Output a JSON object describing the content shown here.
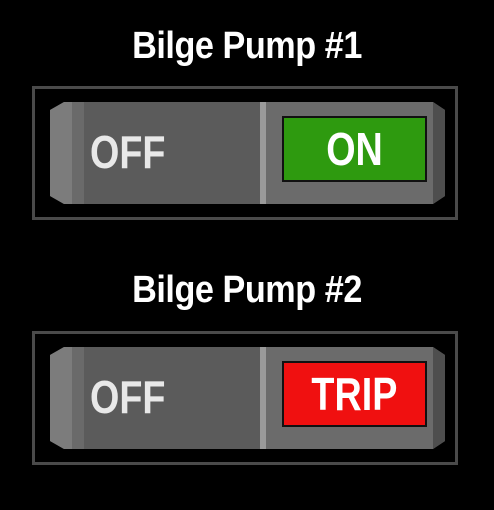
{
  "pumps": [
    {
      "title": "Bilge Pump #1",
      "off_label": "OFF",
      "state_label": "ON",
      "state_color": "#2e9a0f"
    },
    {
      "title": "Bilge Pump #2",
      "off_label": "OFF",
      "state_label": "TRIP",
      "state_color": "#f01010"
    }
  ]
}
